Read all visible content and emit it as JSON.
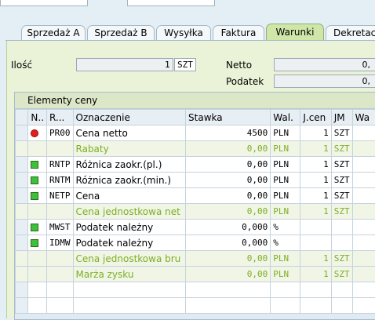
{
  "tabs": [
    {
      "label": "Sprzedaż A",
      "active": false
    },
    {
      "label": "Sprzedaż B",
      "active": false
    },
    {
      "label": "Wysyłka",
      "active": false
    },
    {
      "label": "Faktura",
      "active": false
    },
    {
      "label": "Warunki",
      "active": true
    },
    {
      "label": "Dekretacja",
      "active": false
    }
  ],
  "header": {
    "quantity_label": "Ilość",
    "quantity_value": "1",
    "quantity_unit": "SZT",
    "net_label": "Netto",
    "net_value": "0,",
    "tax_label": "Podatek",
    "tax_value": "0,"
  },
  "grid": {
    "title": "Elementy ceny",
    "columns": [
      "N..",
      "R...",
      "Oznaczenie",
      "Stawka",
      "Wal.",
      "J.cen",
      "JM",
      "Wa"
    ],
    "rows": [
      {
        "status": "red",
        "code": "PR00",
        "name": "Cena netto",
        "rate": "4500",
        "currency": "PLN",
        "price_unit": "1",
        "uom": "SZT",
        "subtotal": false
      },
      {
        "status": "",
        "code": "",
        "name": "Rabaty",
        "rate": "0,00",
        "currency": "PLN",
        "price_unit": "1",
        "uom": "SZT",
        "subtotal": true
      },
      {
        "status": "green",
        "code": "RNTP",
        "name": "Różnica zaokr.(pl.)",
        "rate": "0,00",
        "currency": "PLN",
        "price_unit": "1",
        "uom": "SZT",
        "subtotal": false
      },
      {
        "status": "green",
        "code": "RNTM",
        "name": "Różnica zaokr.(min.)",
        "rate": "0,00",
        "currency": "PLN",
        "price_unit": "1",
        "uom": "SZT",
        "subtotal": false
      },
      {
        "status": "green",
        "code": "NETP",
        "name": "Cena",
        "rate": "0,00",
        "currency": "PLN",
        "price_unit": "1",
        "uom": "SZT",
        "subtotal": false
      },
      {
        "status": "",
        "code": "",
        "name": "Cena jednostkowa net",
        "rate": "0,00",
        "currency": "PLN",
        "price_unit": "1",
        "uom": "SZT",
        "subtotal": true
      },
      {
        "status": "green",
        "code": "MWST",
        "name": "Podatek należny",
        "rate": "0,000",
        "currency": "%",
        "price_unit": "",
        "uom": "",
        "subtotal": false
      },
      {
        "status": "green",
        "code": "IDMW",
        "name": "Podatek należny",
        "rate": "0,000",
        "currency": "%",
        "price_unit": "",
        "uom": "",
        "subtotal": false
      },
      {
        "status": "",
        "code": "",
        "name": "Cena jednostkowa bru",
        "rate": "0,00",
        "currency": "PLN",
        "price_unit": "1",
        "uom": "SZT",
        "subtotal": true
      },
      {
        "status": "",
        "code": "",
        "name": "Marża zysku",
        "rate": "0,00",
        "currency": "PLN",
        "price_unit": "1",
        "uom": "SZT",
        "subtotal": true
      },
      {
        "status": "",
        "code": "",
        "name": "",
        "rate": "",
        "currency": "",
        "price_unit": "",
        "uom": "",
        "subtotal": false
      },
      {
        "status": "",
        "code": "",
        "name": "",
        "rate": "",
        "currency": "",
        "price_unit": "",
        "uom": "",
        "subtotal": false
      }
    ]
  }
}
